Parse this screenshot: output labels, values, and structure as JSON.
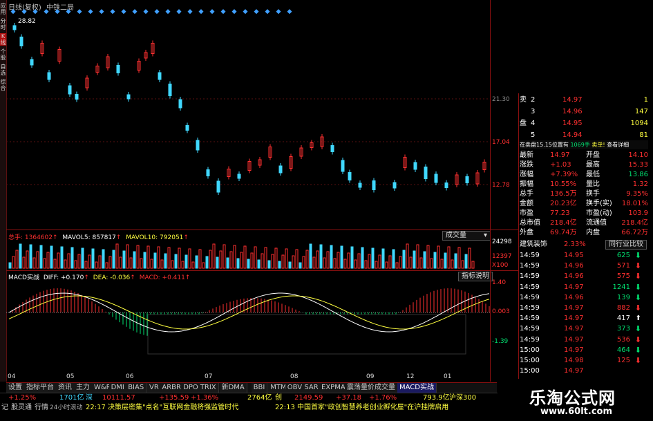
{
  "chart_header": {
    "period": "日线(复权)",
    "stock_name": "中铁二局"
  },
  "left_strip": [
    "应用",
    "分时",
    "K线",
    "个股",
    "自选",
    "综合"
  ],
  "price_axis": {
    "high_mark": "28.82",
    "labels": [
      "21.30",
      "17.04",
      "12.78"
    ]
  },
  "volume": {
    "label": "总手: 1364602",
    "mavol5": "MAVOL5: 857817",
    "mavol10": "MAVOL10: 792051",
    "axis": [
      "24298",
      "12397",
      "X100"
    ],
    "button": "成交量"
  },
  "macd": {
    "label": "MACD实战",
    "diff": "DIFF: +0.170",
    "dea": "DEA: -0.036",
    "macd": "MACD: +0.411",
    "axis": [
      "1.40",
      "0.003",
      "-1.39"
    ],
    "button": "指标说明"
  },
  "date_axis": [
    "04",
    "05",
    "06",
    "07",
    "08",
    "09",
    "12",
    "01"
  ],
  "tabs": [
    "设置",
    "指标平台",
    "资讯",
    "主力",
    "W&R",
    "DMI",
    "BIAS",
    "VR",
    "ARBR",
    "DPO",
    "TRIX",
    "新DMA",
    "BBI",
    "MTM",
    "OBV",
    "SAR",
    "EXPMA",
    "震荡量价成交量",
    "MACD实战"
  ],
  "order_book": {
    "sell": [
      {
        "label": "卖",
        "level": "2",
        "price": "14.97",
        "vol": "1"
      },
      {
        "label": "",
        "level": "3",
        "price": "14.96",
        "vol": "147"
      },
      {
        "label": "盘",
        "level": "4",
        "price": "14.95",
        "vol": "1094"
      },
      {
        "label": "",
        "level": "5",
        "price": "14.94",
        "vol": "81"
      }
    ]
  },
  "order_info": {
    "text1": "在卖盘15.15位置有",
    "text2": "1069手",
    "text3": "卖单!",
    "text4": "查看详细"
  },
  "quote": [
    {
      "k1": "最新",
      "v1": "14.97",
      "k2": "开盘",
      "v2": "14.10"
    },
    {
      "k1": "涨跌",
      "v1": "+1.03",
      "k2": "最高",
      "v2": "15.33"
    },
    {
      "k1": "涨幅",
      "v1": "+7.39%",
      "k2": "最低",
      "v2": "13.86"
    },
    {
      "k1": "振幅",
      "v1": "10.55%",
      "k2": "量比",
      "v2": "1.32"
    },
    {
      "k1": "总手",
      "v1": "136.5万",
      "k2": "换手",
      "v2": "9.35%"
    },
    {
      "k1": "金额",
      "v1": "20.23亿",
      "k2": "换手(实)",
      "v2": "18.01%"
    },
    {
      "k1": "市盈",
      "v1": "77.23",
      "k2": "市盈(动)",
      "v2": "103.9"
    },
    {
      "k1": "总市值",
      "v1": "218.4亿",
      "k2": "流通值",
      "v2": "218.4亿"
    },
    {
      "k1": "外盘",
      "v1": "69.74万",
      "k2": "内盘",
      "v2": "66.72万"
    }
  ],
  "sector": {
    "name": "建筑装饰",
    "change": "2.33%",
    "button": "同行业比较"
  },
  "ticks": [
    {
      "time": "14:59",
      "price": "14.95",
      "vol": "625",
      "dir": "down"
    },
    {
      "time": "14:59",
      "price": "14.96",
      "vol": "571",
      "dir": "up"
    },
    {
      "time": "14:59",
      "price": "14.96",
      "vol": "575",
      "dir": "up"
    },
    {
      "time": "14:59",
      "price": "14.97",
      "vol": "1241",
      "dir": "down"
    },
    {
      "time": "14:59",
      "price": "14.96",
      "vol": "139",
      "dir": "down"
    },
    {
      "time": "14:59",
      "price": "14.97",
      "vol": "882",
      "dir": "up"
    },
    {
      "time": "14:59",
      "price": "14.97",
      "vol": "417",
      "dir": "none"
    },
    {
      "time": "14:59",
      "price": "14.97",
      "vol": "373",
      "dir": "down"
    },
    {
      "time": "14:59",
      "price": "14.97",
      "vol": "536",
      "dir": "up"
    },
    {
      "time": "15:00",
      "price": "14.97",
      "vol": "464",
      "dir": "down"
    },
    {
      "time": "15:00",
      "price": "14.98",
      "vol": "125",
      "dir": "up"
    },
    {
      "time": "15:00",
      "price": "14.97",
      "vol": "",
      "dir": "none"
    }
  ],
  "status": {
    "pct1": "+1.25%",
    "amt1": "1701亿",
    "idx_name": "深",
    "idx": "10111.57",
    "chg": "+135.59",
    "pct2": "+1.36%",
    "amt2": "2764亿",
    "cy_name": "创",
    "cy": "2149.59",
    "cy_chg": "+37.18",
    "cy_pct": "+1.76%",
    "hs_amt": "793.9亿",
    "hs_name": "沪深300"
  },
  "news": {
    "tabs": [
      "记",
      "股灵通",
      "行情",
      "24小时滚动"
    ],
    "time1": "22:17",
    "text1": "决策层密集\"点名\"互联网金融将强监管时代",
    "time2": "22:13",
    "text2": "中国首家\"政创智慧养老创业孵化屋\"在沪挂牌启用"
  },
  "watermark": {
    "title": "乐淘公式网",
    "url": "www.60lt.com"
  },
  "colors": {
    "up": "#ff3030",
    "down": "#40d8ff",
    "border": "#8b1010",
    "bg": "#000000"
  }
}
